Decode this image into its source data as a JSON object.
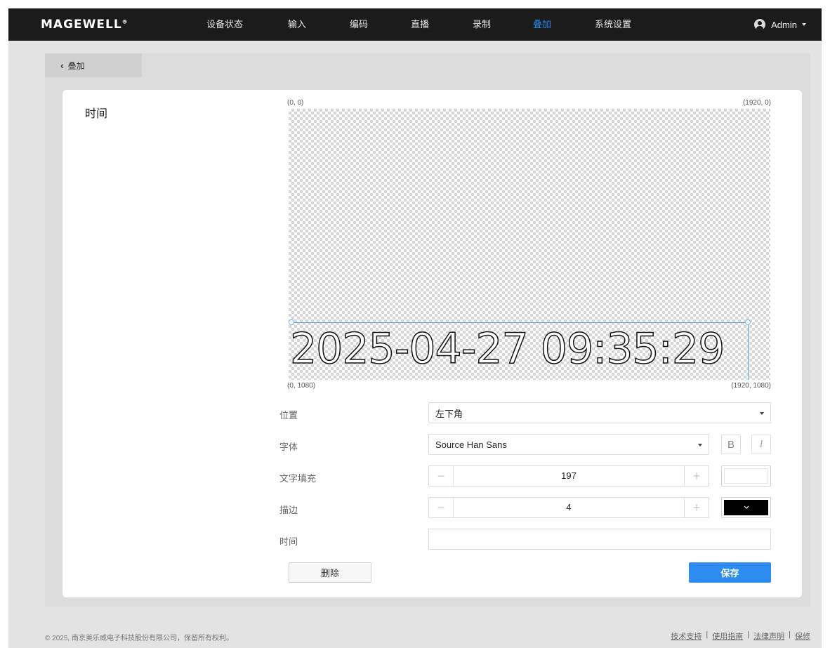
{
  "header": {
    "logo": "MAGEWELL",
    "logo_mark": "®",
    "nav": [
      {
        "label": "设备状态",
        "active": false
      },
      {
        "label": "输入",
        "active": false
      },
      {
        "label": "编码",
        "active": false
      },
      {
        "label": "直播",
        "active": false
      },
      {
        "label": "录制",
        "active": false
      },
      {
        "label": "叠加",
        "active": true
      },
      {
        "label": "系统设置",
        "active": false
      }
    ],
    "user": "Admin"
  },
  "back_button": {
    "label": "叠加",
    "icon": "chevron-left-icon"
  },
  "card": {
    "title": "时间",
    "canvas": {
      "coord_top_left": "(0, 0)",
      "coord_top_right": "(1920, 0)",
      "coord_bottom_left": "(0, 1080)",
      "coord_bottom_right": "(1920, 1080)",
      "overlay_text": "2025-04-27 09:35:29"
    },
    "form": {
      "position_label": "位置",
      "position_value": "左下角",
      "font_label": "字体",
      "font_value": "Source Han Sans",
      "bold_label": "B",
      "italic_label": "I",
      "fill_label": "文字填充",
      "fill_value": "197",
      "fill_color": "#ffffff",
      "stroke_label": "描边",
      "stroke_value": "4",
      "stroke_color": "#000000",
      "time_label": "时间",
      "time_value": ""
    },
    "buttons": {
      "delete": "删除",
      "save": "保存"
    }
  },
  "footer": {
    "copyright": "© 2025, 南京美乐威电子科技股份有限公司，保留所有权利。",
    "links": [
      "技术支持",
      "使用指南",
      "法律声明",
      "保修"
    ]
  },
  "colors": {
    "accent": "#2d8cf0",
    "header_bg": "#1b1b1b"
  }
}
